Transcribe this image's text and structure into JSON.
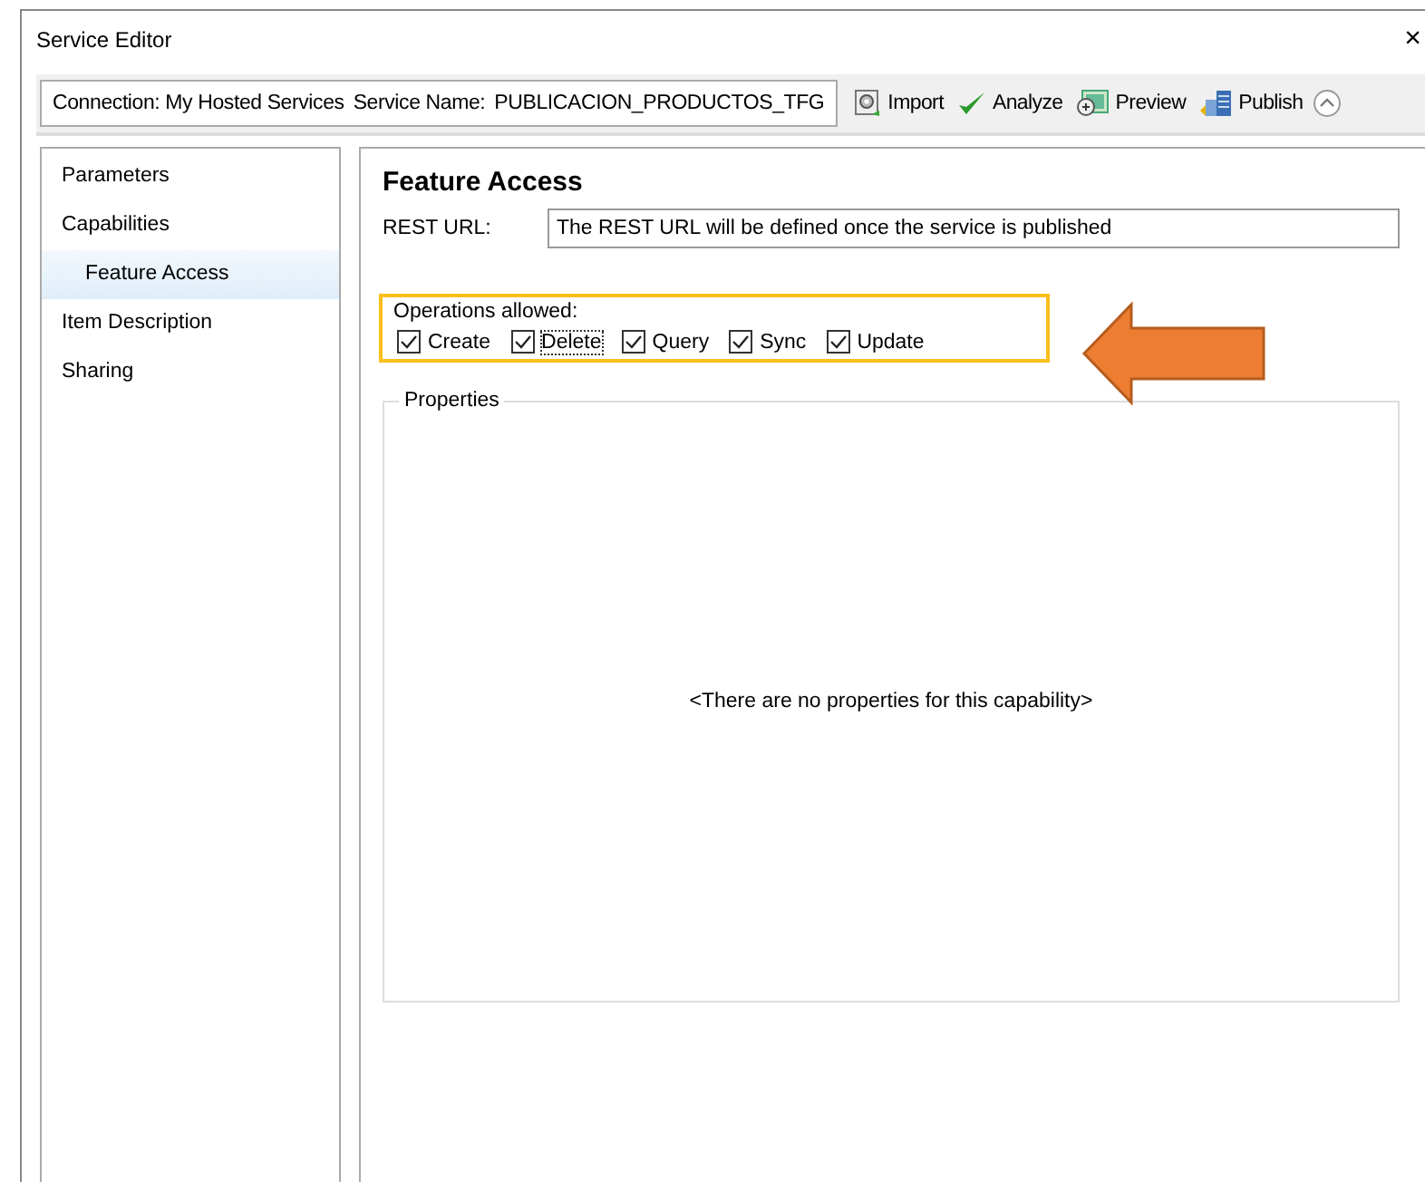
{
  "window": {
    "title": "Service Editor",
    "close": "×"
  },
  "toolbar": {
    "connection": "Connection: My Hosted Services",
    "service_name_label": "Service Name:",
    "service_name": "PUBLICACION_PRODUCTOS_TFG",
    "buttons": [
      {
        "label": "Import",
        "kind": "import"
      },
      {
        "label": "Analyze",
        "kind": "analyze"
      },
      {
        "label": "Preview",
        "kind": "preview"
      },
      {
        "label": "Publish",
        "kind": "publish"
      }
    ]
  },
  "sidebar": {
    "items": [
      {
        "label": "Parameters",
        "selected": false
      },
      {
        "label": "Capabilities",
        "selected": false,
        "children": [
          {
            "label": "Feature Access",
            "selected": true
          }
        ]
      },
      {
        "label": "Item Description",
        "selected": false
      },
      {
        "label": "Sharing",
        "selected": false
      }
    ]
  },
  "content": {
    "heading": "Feature Access",
    "rest_url_label": "REST URL:",
    "rest_url": "The REST URL will be defined once the service is published",
    "operations": {
      "label": "Operations allowed:",
      "items": [
        {
          "label": "Create",
          "checked": true,
          "focused": false
        },
        {
          "label": "Delete",
          "checked": true,
          "focused": true
        },
        {
          "label": "Query",
          "checked": true,
          "focused": false
        },
        {
          "label": "Sync",
          "checked": true,
          "focused": false
        },
        {
          "label": "Update",
          "checked": true,
          "focused": false
        }
      ]
    },
    "properties": {
      "title": "Properties",
      "empty_text": "<There are no properties for this capability>"
    }
  }
}
